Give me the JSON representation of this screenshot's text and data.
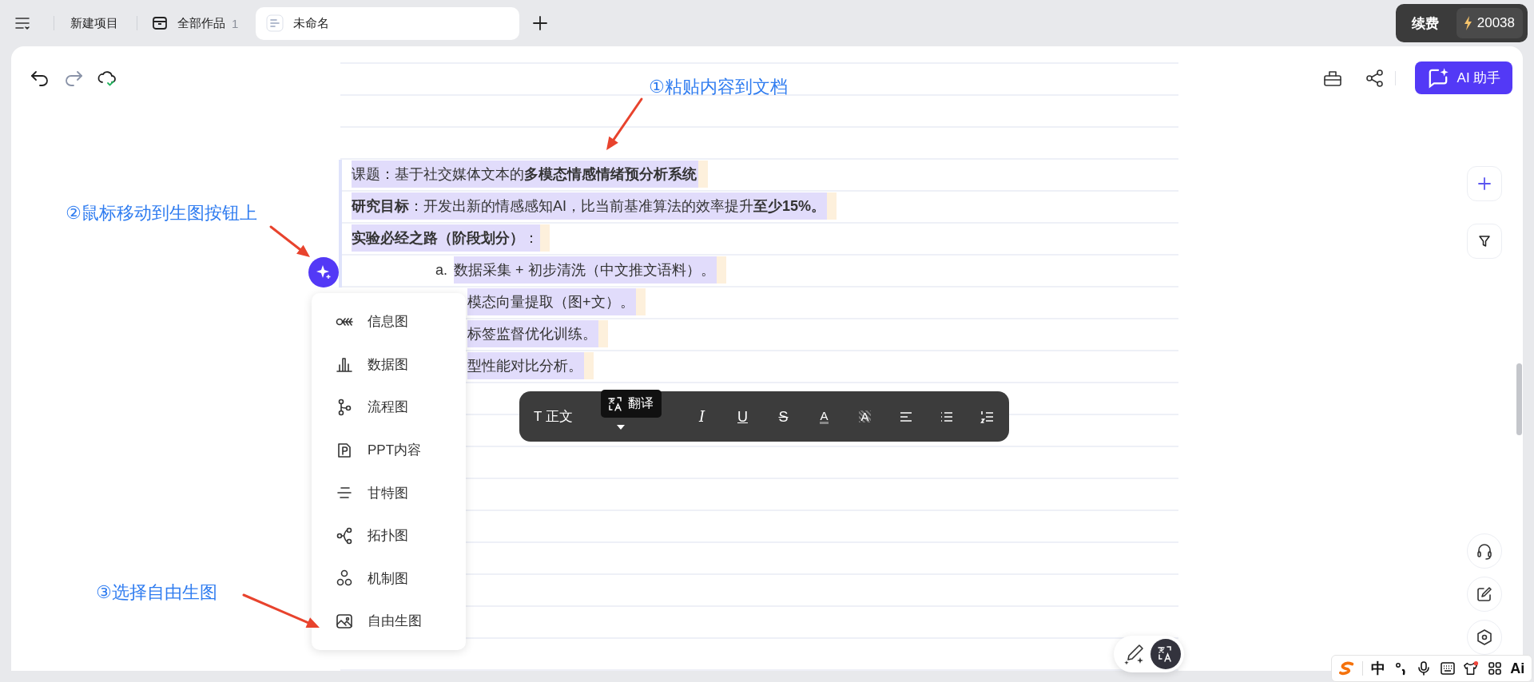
{
  "top_bar": {
    "new_project": "新建项目",
    "tabs": [
      {
        "label": "全部作品",
        "count": "1",
        "selected": false
      },
      {
        "label": "未命名",
        "selected": true
      }
    ]
  },
  "renewal": {
    "label": "续费",
    "points": "20038"
  },
  "header": {
    "ai_button": "AI 助手"
  },
  "document": {
    "lines": [
      {
        "kind": "paragraph",
        "text": "课题：基于社交媒体文本的**多模态情感情绪预分析系统**",
        "selected": true
      },
      {
        "kind": "paragraph",
        "text": "**研究目标**：开发出新的情感感知AI，比当前基准算法的效率提升**至少15%。**",
        "selected": true
      },
      {
        "kind": "paragraph",
        "text": "**实验必经之路（阶段划分）**：",
        "selected": true
      },
      {
        "kind": "list_item",
        "marker": "a.",
        "text": "数据采集 + 初步清洗（中文推文语料）。",
        "selected": true
      },
      {
        "kind": "list_item",
        "text": "模态向量提取（图+文）。",
        "selected": true
      },
      {
        "kind": "list_item",
        "text": "标签监督优化训练。",
        "selected": true
      },
      {
        "kind": "list_item",
        "text": "型性能对比分析。",
        "selected": true
      }
    ]
  },
  "insert_menu": {
    "items": [
      {
        "label": "信息图"
      },
      {
        "label": "数据图"
      },
      {
        "label": "流程图"
      },
      {
        "label": "PPT内容"
      },
      {
        "label": "甘特图"
      },
      {
        "label": "拓扑图"
      },
      {
        "label": "机制图"
      },
      {
        "label": "自由生图"
      }
    ]
  },
  "format_bar": {
    "style": "T 正文",
    "tooltip": "翻译",
    "buttons": [
      {
        "kind": "italic",
        "glyph": "I"
      },
      {
        "kind": "underline",
        "glyph": "U"
      },
      {
        "kind": "strike",
        "glyph": "S"
      },
      {
        "kind": "color",
        "glyph": "A"
      },
      {
        "kind": "highlight",
        "glyph": "A"
      },
      {
        "kind": "align"
      },
      {
        "kind": "bullets"
      },
      {
        "kind": "numbers"
      }
    ]
  },
  "annotations": [
    {
      "text": "①粘贴内容到文档"
    },
    {
      "text": "②鼠标移动到生图按钮上"
    },
    {
      "text": "③选择自由生图"
    }
  ],
  "ime_bar": {
    "mode": "中",
    "ai": "Ai"
  }
}
